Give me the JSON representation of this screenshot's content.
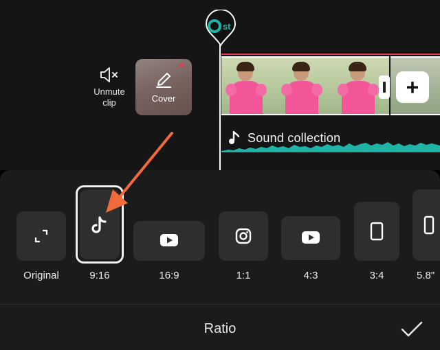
{
  "timeline": {
    "unmute_label": "Unmute\nclip",
    "cover_label": "Cover",
    "audio_label": "Sound collection",
    "playhead_badge": "st"
  },
  "ratios": [
    {
      "label": "Original",
      "icon": "expand-icon"
    },
    {
      "label": "9:16",
      "icon": "tiktok-icon",
      "selected": true
    },
    {
      "label": "16:9",
      "icon": "youtube-icon"
    },
    {
      "label": "1:1",
      "icon": "instagram-icon"
    },
    {
      "label": "4:3",
      "icon": "youtube-icon"
    },
    {
      "label": "3:4",
      "icon": "portrait-rect-icon"
    },
    {
      "label": "5.8\"",
      "icon": "phone-icon"
    }
  ],
  "footer": {
    "title": "Ratio",
    "confirm_icon": "checkmark-icon"
  },
  "colors": {
    "accent_teal": "#1fb3a5",
    "annotation_arrow": "#f26a3a",
    "clip_marker": "#e23a4f"
  }
}
